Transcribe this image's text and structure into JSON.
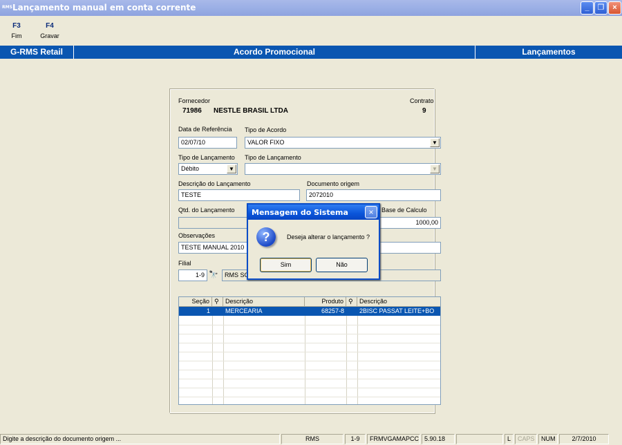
{
  "window": {
    "icon_text": "RMS",
    "title": "Lançamento manual em conta corrente"
  },
  "toolbar": {
    "keys": [
      {
        "key": "F3",
        "label": "Fim"
      },
      {
        "key": "F4",
        "label": "Gravar"
      }
    ]
  },
  "header_band": {
    "left": "G-RMS Retail",
    "center": "Acordo Promocional",
    "right": "Lançamentos"
  },
  "form": {
    "fornecedor_label": "Fornecedor",
    "fornecedor_code": "71986",
    "fornecedor_name": "NESTLE BRASIL LTDA",
    "contrato_label": "Contrato",
    "contrato_value": "9",
    "data_ref_label": "Data de Referência",
    "data_ref_value": "02/07/10",
    "tipo_acordo_label": "Tipo de  Acordo",
    "tipo_acordo_value": "VALOR FIXO",
    "tipo_lanc_label": "Tipo de Lançamento",
    "tipo_lanc_value": "Débito",
    "tipo_lanc2_label": "Tipo de Lançamento",
    "tipo_lanc2_value": "",
    "descricao_label": "Descrição do Lançamento",
    "descricao_value": "TESTE",
    "doc_origem_label": "Documento origem",
    "doc_origem_value": "2072010",
    "qtd_label": "Qtd. do Lançamento",
    "qtd_value": "",
    "base_calc_label": "Base de Calculo",
    "base_calc_value": "1000,00",
    "obs_label": "Observações",
    "obs_value": "TESTE MANUAL 2010",
    "filial_label": "Filial",
    "filial_value": "1-9",
    "filial_name": "RMS SO"
  },
  "grid": {
    "headers": [
      "Seção",
      "Descrição",
      "Produto",
      "Descrição"
    ],
    "rows": [
      {
        "secao": "1",
        "descricao": "MERCEARIA",
        "produto": "68257-8",
        "descricao2": "2BISC PASSAT LEITE+BO"
      }
    ]
  },
  "dialog": {
    "title": "Mensagem do Sistema",
    "icon": "?",
    "message": "Deseja alterar o lançamento ?",
    "yes_label": "Sim",
    "no_label": "Não"
  },
  "statusbar": {
    "message": "Digite a descrição do documento origem ...",
    "cells": [
      "RMS",
      "1-9",
      "FRMVGAMAPCC",
      "5.90.18",
      "",
      "L",
      "CAPS",
      "NUM",
      "2/7/2010"
    ]
  },
  "colors": {
    "band": "#0a56b1",
    "selected_row": "#0a56b1",
    "dialog_title": "#0a55d9"
  }
}
